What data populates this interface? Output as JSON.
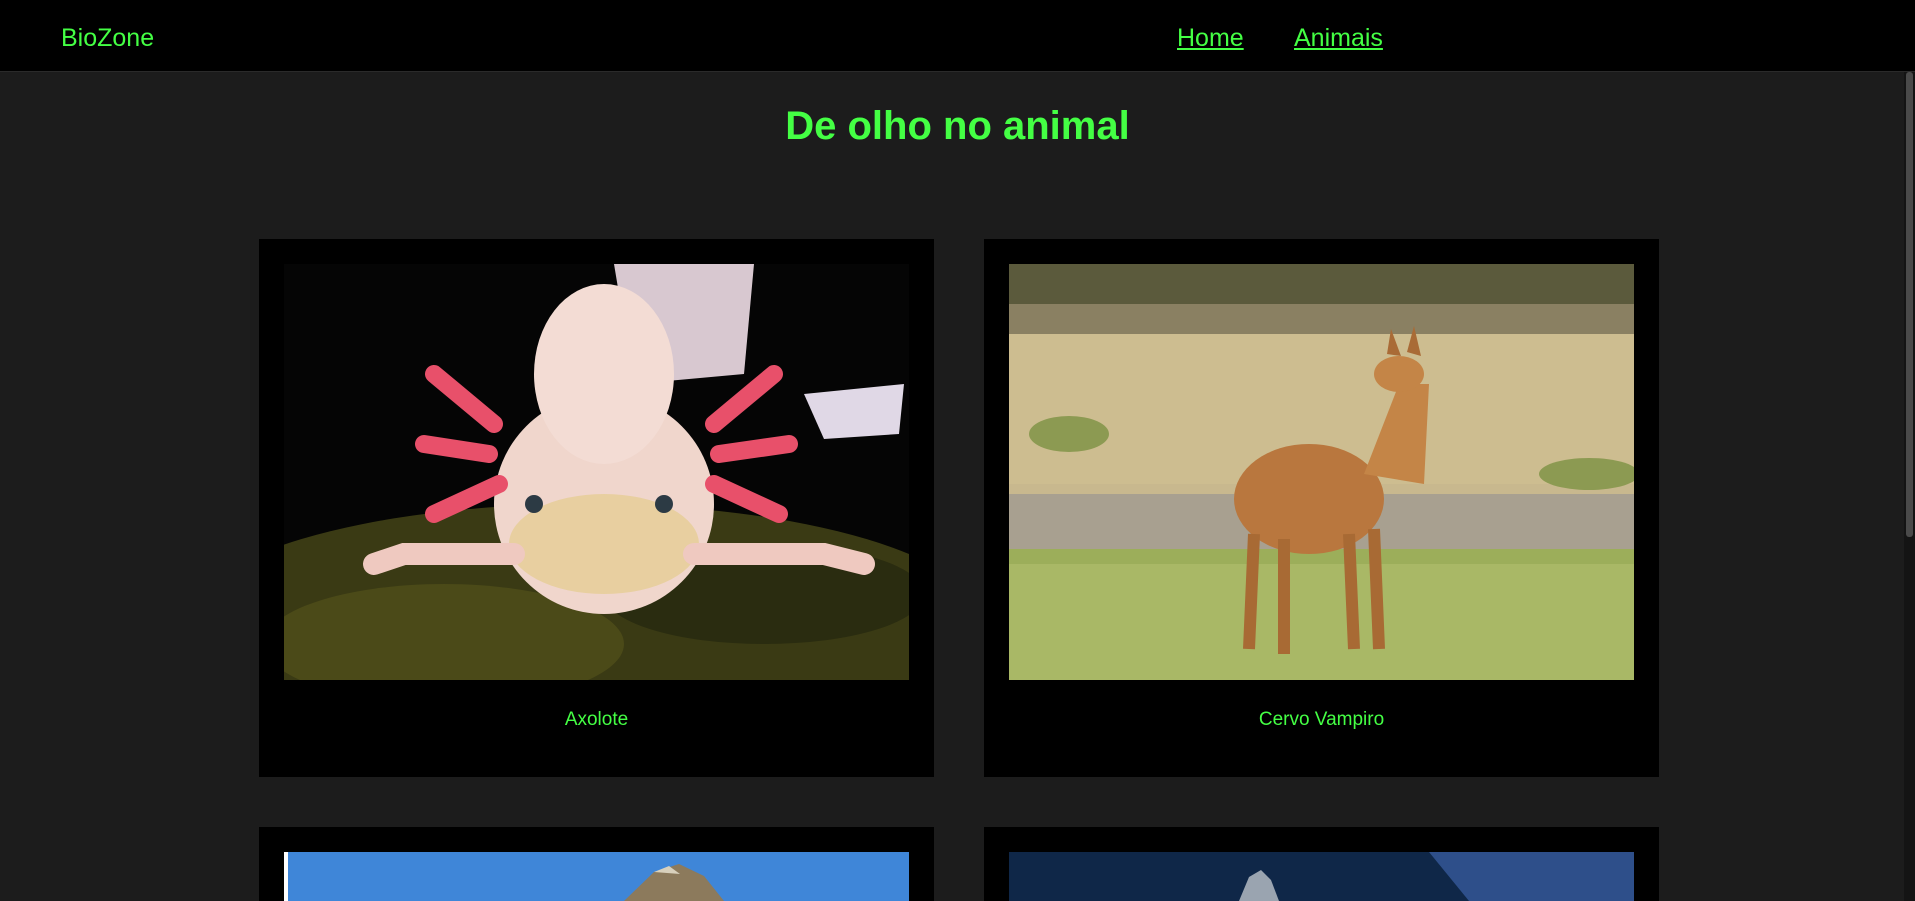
{
  "header": {
    "brand": "BioZone",
    "nav": [
      {
        "label": "Home"
      },
      {
        "label": "Animais"
      }
    ]
  },
  "main": {
    "title": "De olho no animal",
    "cards": [
      {
        "caption": "Axolote",
        "image": "axolotl-photo"
      },
      {
        "caption": "Cervo Vampiro",
        "image": "water-deer-photo"
      },
      {
        "caption": "",
        "image": "rock-animal-photo"
      },
      {
        "caption": "",
        "image": "deep-sea-photo"
      }
    ]
  },
  "colors": {
    "accent": "#44ff44",
    "background": "#1c1c1c",
    "surface": "#000000"
  }
}
